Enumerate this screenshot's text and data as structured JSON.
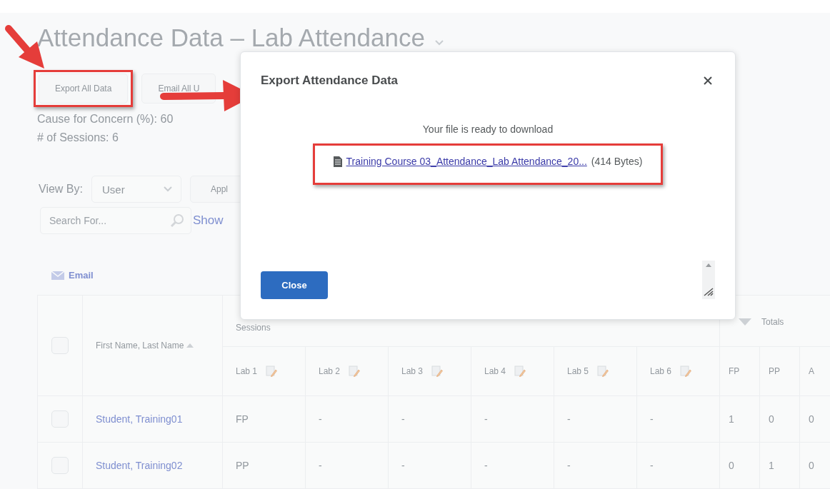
{
  "page": {
    "title": "Attendance Data – Lab Attendance",
    "actions": [
      {
        "label": "Export All Data",
        "highlighted": true
      },
      {
        "label": "Email All U",
        "highlighted": false
      }
    ],
    "stats": [
      "Cause for Concern (%): 60",
      "# of Sessions: 6"
    ],
    "view_by": {
      "label": "View By:",
      "value": "User"
    },
    "apply_button": "Appl",
    "search": {
      "placeholder": "Search For..."
    },
    "show_link": "Show",
    "email_link": "Email"
  },
  "table": {
    "select_all_checked": false,
    "name_column": "First Name, Last Name",
    "sessions_heading": "Sessions",
    "totals_heading": "Totals",
    "session_columns": [
      "Lab 1",
      "Lab 2",
      "Lab 3",
      "Lab 4",
      "Lab 5",
      "Lab 6"
    ],
    "total_columns": [
      "FP",
      "PP",
      "A"
    ],
    "rows": [
      {
        "name": "Student, Training01",
        "checked": false,
        "sessions": [
          "FP",
          "-",
          "-",
          "-",
          "-",
          "-"
        ],
        "totals": [
          "1",
          "0",
          "0"
        ]
      },
      {
        "name": "Student, Training02",
        "checked": false,
        "sessions": [
          "PP",
          "-",
          "-",
          "-",
          "-",
          "-"
        ],
        "totals": [
          "0",
          "1",
          "0"
        ]
      }
    ]
  },
  "dialog": {
    "title": "Export Attendance Data",
    "message": "Your file is ready to download",
    "file_link": "Training Course 03_Attendance_Lab Attendance_20...",
    "file_size": "(414 Bytes)",
    "highlighted": true,
    "close_button": "Close"
  }
}
